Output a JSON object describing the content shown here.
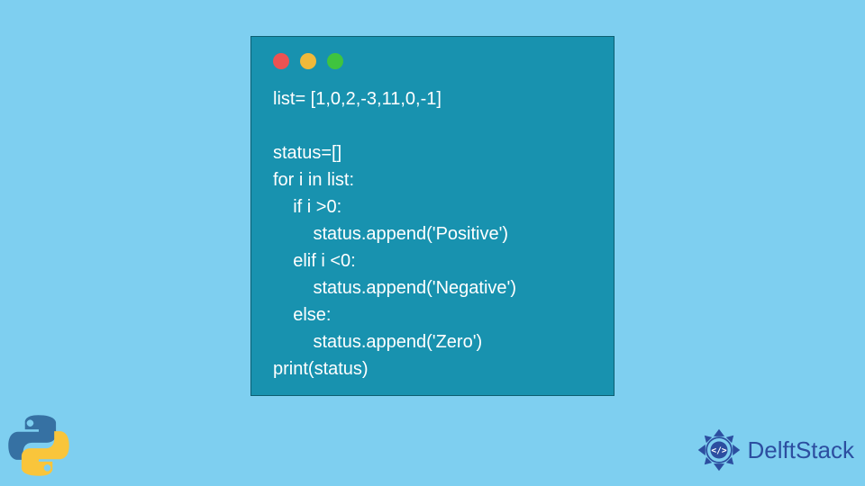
{
  "code_window": {
    "traffic_lights": [
      "red",
      "yellow",
      "green"
    ],
    "lines": [
      "list= [1,0,2,-3,11,0,-1]",
      "",
      "status=[]",
      "for i in list:",
      "    if i >0:",
      "        status.append('Positive')",
      "    elif i <0:",
      "        status.append('Negative')",
      "    else:",
      "        status.append('Zero')",
      "print(status)"
    ]
  },
  "logos": {
    "python": "python-logo",
    "brand_text": "DelftStack"
  },
  "colors": {
    "page_bg": "#7ecff0",
    "window_bg": "#1892af",
    "code_text": "#ffffff",
    "brand_text": "#2c4ea0"
  }
}
